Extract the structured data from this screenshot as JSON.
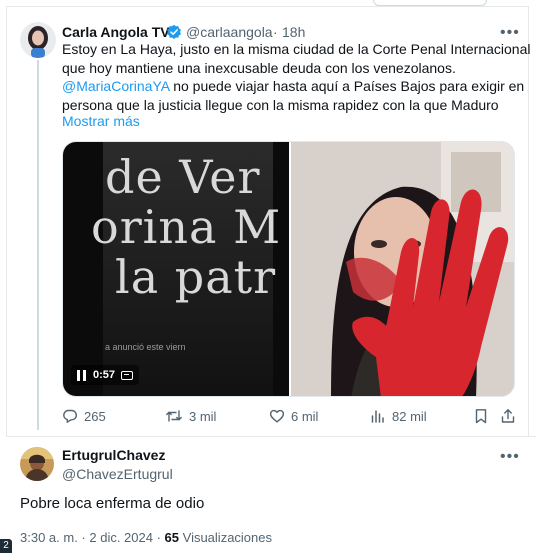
{
  "main_tweet": {
    "author_name": "Carla Angola TV",
    "verified": true,
    "handle": "@carlaangola",
    "separator": "·",
    "time_ago": "18h",
    "text_lines": [
      "Estoy en La Haya, justo en la misma ciudad de la Corte Penal Internacional",
      "que hoy mantiene una inexcusable deuda con los venezolanos."
    ],
    "mention": "@MariaCorinaYA",
    "text_after_mention": " no puede viajar hasta aquí a Países Bajos para exigir en",
    "text_line_last": "persona que la justicia llegue con la misma rapidez con la que Maduro",
    "show_more": "Mostrar más",
    "media": {
      "video": {
        "timecode": "0:57",
        "overlay_words": [
          "de Ver",
          "orina M",
          "la patr"
        ],
        "caption_fragment": "a anunció este viern"
      },
      "photo": {
        "description_icon": "photo-red-handprint"
      }
    },
    "actions": {
      "replies": "265",
      "reposts": "3 mil",
      "likes": "6 mil",
      "views": "82 mil"
    },
    "more_icon": "more-horizontal-icon"
  },
  "reply": {
    "author_name": "ErtugrulChavez",
    "handle": "@ChavezErtugrul",
    "text": "Pobre loca enferma de odio",
    "time": "3:30 a. m.",
    "separator": " · ",
    "date": "2 dic. 2024",
    "separator2": " · ",
    "views_count": "65",
    "views_label": " Visualizaciones"
  },
  "corner_badge": "2",
  "colors": {
    "accent": "#1d9bf0",
    "muted": "#536471",
    "text": "#0f1419",
    "border": "#e6e9eb"
  }
}
